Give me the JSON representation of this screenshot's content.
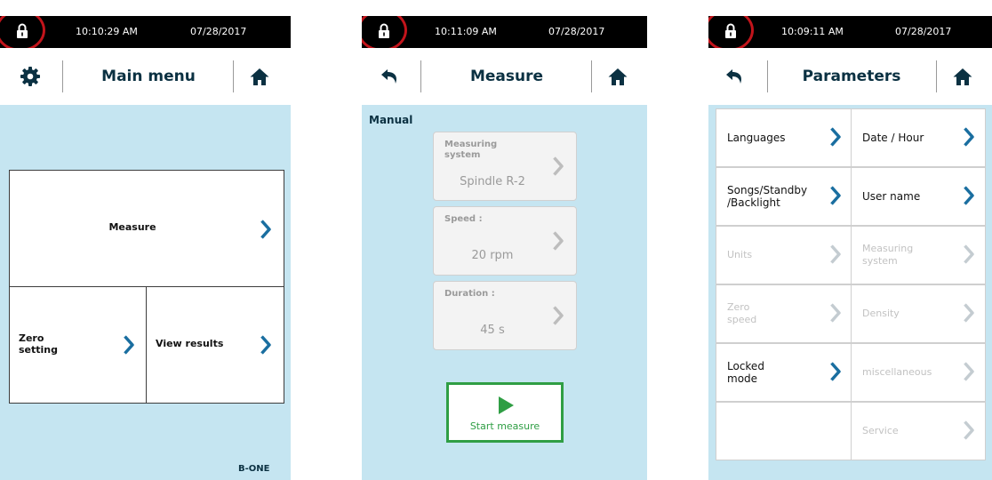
{
  "colors": {
    "accent": "#1a6ea0",
    "disabled": "#c4ccd1",
    "lock_ring": "#c2141b",
    "start": "#2f9e44",
    "background": "#c5e5f1"
  },
  "screens": [
    {
      "status": {
        "time": "10:10:29 AM",
        "date": "07/28/2017"
      },
      "header": {
        "title": "Main menu",
        "left_icon": "gear-icon",
        "right_icon": "home-icon"
      },
      "tiles": {
        "measure": "Measure",
        "zero": "Zero\nsetting",
        "results": "View results"
      },
      "brand": "B-ONE"
    },
    {
      "status": {
        "time": "10:11:09 AM",
        "date": "07/28/2017"
      },
      "header": {
        "title": "Measure",
        "left_icon": "back-arrow-icon",
        "right_icon": "home-icon"
      },
      "mode": "Manual",
      "cards": [
        {
          "title": "Measuring\nsystem",
          "value": "Spindle R-2"
        },
        {
          "title": "Speed :",
          "value": "20 rpm"
        },
        {
          "title": "Duration :",
          "value": "45 s"
        }
      ],
      "start_label": "Start measure",
      "start_icon": "play-icon"
    },
    {
      "status": {
        "time": "10:09:11 AM",
        "date": "07/28/2017"
      },
      "header": {
        "title": "Parameters",
        "left_icon": "back-arrow-icon",
        "right_icon": "home-icon"
      },
      "items": [
        {
          "label": "Languages",
          "enabled": true
        },
        {
          "label": "Date / Hour",
          "enabled": true
        },
        {
          "label": "Songs/Standby\n/Backlight",
          "enabled": true
        },
        {
          "label": "User name",
          "enabled": true
        },
        {
          "label": "Units",
          "enabled": false
        },
        {
          "label": "Measuring\nsystem",
          "enabled": false
        },
        {
          "label": "Zero\nspeed",
          "enabled": false
        },
        {
          "label": "Density",
          "enabled": false
        },
        {
          "label": "Locked\nmode",
          "enabled": true
        },
        {
          "label": "miscellaneous",
          "enabled": false
        },
        {
          "label": "",
          "enabled": false
        },
        {
          "label": "Service",
          "enabled": false
        }
      ]
    }
  ]
}
